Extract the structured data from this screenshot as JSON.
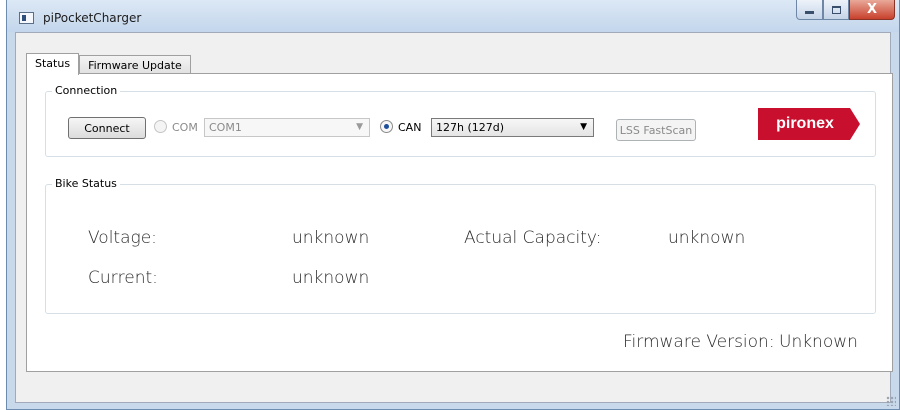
{
  "window": {
    "title": "piPocketCharger"
  },
  "caption_buttons": {
    "close_glyph": "X"
  },
  "tabs": [
    {
      "label": "Status"
    },
    {
      "label": "Firmware Update"
    }
  ],
  "connection": {
    "group_title": "Connection",
    "connect_label": "Connect",
    "com_label": "COM",
    "com_port_value": "COM1",
    "can_label": "CAN",
    "can_id_value": "127h (127d)",
    "lss_label": "LSS FastScan",
    "logo_text": "pironex",
    "logo_color": "#c8102e"
  },
  "bike_status": {
    "group_title": "Bike Status",
    "voltage_label": "Voltage:",
    "voltage_value": "unknown",
    "current_label": "Current:",
    "current_value": "unknown",
    "capacity_label": "Actual Capacity:",
    "capacity_value": "unknown"
  },
  "firmware": {
    "label": "Firmware Version:",
    "value": "Unknown"
  }
}
